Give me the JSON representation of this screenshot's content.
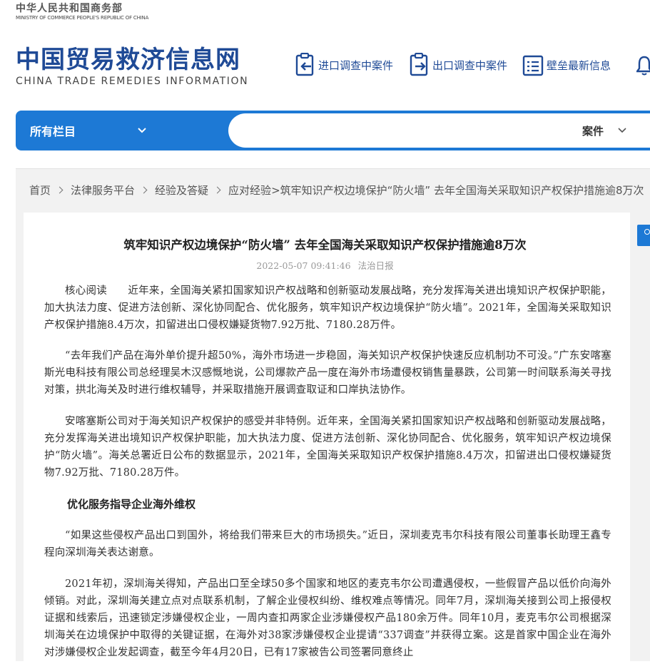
{
  "header": {
    "ministry_cn": "中华人民共和国商务部",
    "ministry_en": "MINISTRY OF COMMERCE PEOPLE'S REPUBLIC OF CHINA",
    "site_title_cn": "中国贸易救济信息网",
    "site_title_en": "CHINA TRADE REMEDIES INFORMATION",
    "quick_links": [
      {
        "label": "进口调查中案件",
        "icon": "import-case-icon"
      },
      {
        "label": "出口调查中案件",
        "icon": "export-case-icon"
      },
      {
        "label": "壁垒最新信息",
        "icon": "barrier-news-icon"
      }
    ],
    "accent_color": "#1f4a96"
  },
  "nav": {
    "menu_label": "所有栏目",
    "search_placeholder": "",
    "scope_label": "案件",
    "bar_color": "#1d79d5"
  },
  "breadcrumb": {
    "items": [
      "首页",
      "法律服务平台",
      "经验及答疑",
      "应对经验"
    ],
    "current": ">筑牢知识产权边境保护“防火墙” 去年全国海关采取知识产权保护措施逾8万次"
  },
  "article": {
    "title": "筑牢知识产权边境保护“防火墙”  去年全国海关采取知识产权保护措施逾8万次",
    "datetime": "2022-05-07 09:41:46",
    "source": "法治日报",
    "paragraphs": [
      "核心阅读　　近年来，全国海关紧扣国家知识产权战略和创新驱动发展战略，充分发挥海关进出境知识产权保护职能，加大执法力度、促进方法创新、深化协同配合、优化服务，筑牢知识产权边境保护“防火墙”。2021年，全国海关采取知识产权保护措施8.4万次，扣留进出口侵权嫌疑货物7.92万批、7180.28万件。",
      "“去年我们产品在海外单价提升超50%，海外市场进一步稳固，海关知识产权保护快速反应机制功不可没。”广东安喀塞斯光电科技有限公司总经理吴木汉感慨地说，公司爆款产品一度在海外市场遭侵权销售量暴跌，公司第一时间联系海关寻找对策，拱北海关及时进行维权辅导，并采取措施开展调查取证和口岸执法协作。",
      "安喀塞斯公司对于海关知识产权保护的感受并非特例。近年来，全国海关紧扣国家知识产权战略和创新驱动发展战略，充分发挥海关进出境知识产权保护职能，加大执法力度、促进方法创新、深化协同配合、优化服务，筑牢知识产权边境保护“防火墙”。海关总署近日公布的数据显示，2021年，全国海关采取知识产权保护措施8.4万次，扣留进出口侵权嫌疑货物7.92万批、7180.28万件。",
      "优化服务指导企业海外维权",
      "“如果这些侵权产品出口到国外，将给我们带来巨大的市场损失。”近日，深圳麦克韦尔科技有限公司董事长助理王鑫专程向深圳海关表达谢意。",
      "2021年初，深圳海关得知，产品出口至全球50多个国家和地区的麦克韦尔公司遭遇侵权，一些假冒产品以低价向海外倾销。对此，深圳海关建立点对点联系机制，了解企业侵权纠纷、维权难点等情况。同年7月，深圳海关接到公司上报侵权证据和线索后，迅速锁定涉嫌侵权企业，一周内查扣两家企业涉嫌侵权产品180余万件。同年10月，麦克韦尔公司根据深圳海关在边境保护中取得的关键证据，在海外对38家涉嫌侵权企业提请“337调查”并获得立案。这是首家中国企业在海外对涉嫌侵权企业发起调查，截至今年4月20日，已有17家被告公司签署同意终止"
    ]
  }
}
